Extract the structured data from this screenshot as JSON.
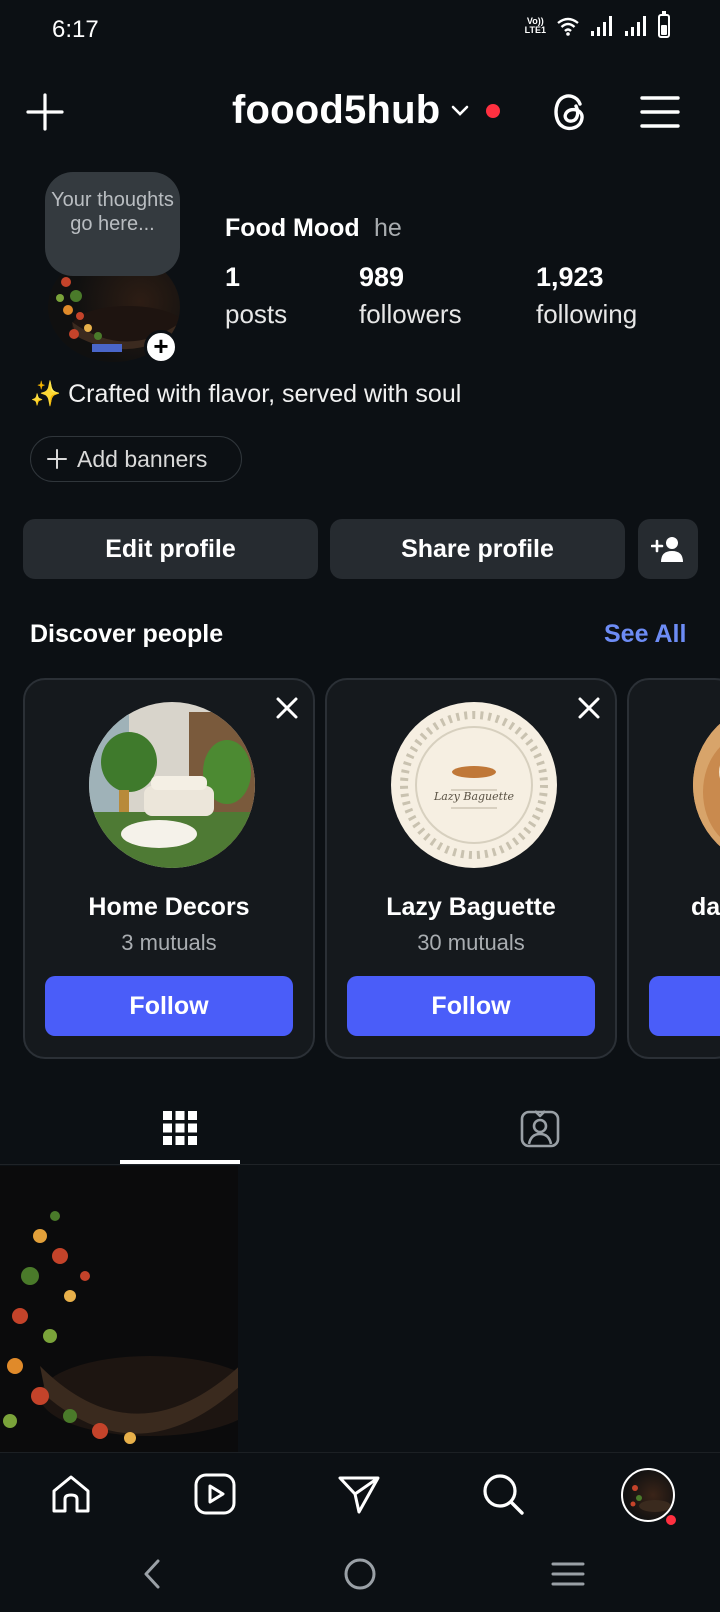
{
  "status_bar": {
    "time": "6:17",
    "volte_label": "Vo))\nLTE1"
  },
  "header": {
    "username": "foood5hub"
  },
  "profile": {
    "note_bubble": "Your thoughts go here...",
    "display_name": "Food Mood",
    "pronouns": "he",
    "stats": [
      {
        "value": "1",
        "label": "posts"
      },
      {
        "value": "989",
        "label": "followers"
      },
      {
        "value": "1,923",
        "label": "following"
      }
    ],
    "bio": "✨ Crafted with flavor, served with soul",
    "add_banners_label": "Add banners"
  },
  "actions": {
    "edit_label": "Edit profile",
    "share_label": "Share profile"
  },
  "discover": {
    "title": "Discover people",
    "see_all_label": "See All",
    "cards": [
      {
        "name": "Home Decors",
        "mutuals": "3 mutuals",
        "follow_label": "Follow"
      },
      {
        "name": "Lazy Baguette",
        "mutuals": "30 mutuals",
        "follow_label": "Follow",
        "logo_text": "Lazy Baguette"
      },
      {
        "name": "da"
      }
    ]
  },
  "tabs": [
    "grid-tab",
    "tagged-tab"
  ],
  "bottom_nav": [
    "home-icon",
    "reels-icon",
    "messages-icon",
    "search-icon",
    "profile-avatar"
  ],
  "colors": {
    "accent_blue": "#4a5df9",
    "link_blue": "#6d8cf5",
    "notification_red": "#ff3040",
    "background": "#0c1014"
  }
}
